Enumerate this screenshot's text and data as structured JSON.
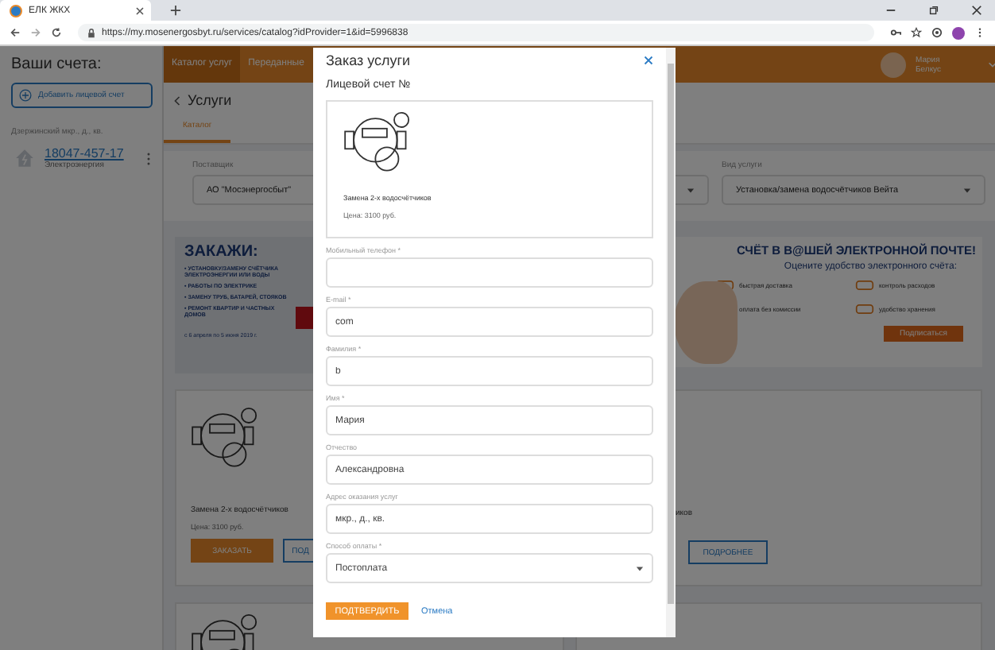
{
  "browser": {
    "tab_title": "ЕЛК ЖКХ",
    "url": "https://my.mosenergosbyt.ru/services/catalog?idProvider=1&id=5996838"
  },
  "sidebar": {
    "title": "Ваши счета:",
    "add_button": "Добавить лицевой счет",
    "address": "Дзержинский мкр., д., кв.",
    "accounts": [
      {
        "number": "18047-457-17",
        "type": "Электроэнергия"
      }
    ]
  },
  "header": {
    "nav": [
      {
        "label": "Каталог услуг",
        "selected": true
      },
      {
        "label": "Переданные",
        "selected": false
      }
    ],
    "user": {
      "first_name": "Мария",
      "last_name": "Белкус"
    }
  },
  "page": {
    "title": "Услуги",
    "tabs": [
      {
        "label": "Каталог",
        "selected": true
      }
    ],
    "filters": [
      {
        "label": "Поставщик",
        "value": "АО \"Мосэнергосбыт\""
      },
      {
        "label": "Вид услуги",
        "value": "Установка/замена водосчётчиков Вейта"
      }
    ],
    "promo_left": {
      "title": "ЗАКАЖИ:",
      "items": [
        "• УСТАНОВКУ/ЗАМЕНУ СЧЁТЧИКА ЭЛЕКТРОЭНЕРГИИ ИЛИ ВОДЫ",
        "• РАБОТЫ ПО ЭЛЕКТРИКЕ",
        "• ЗАМЕНУ ТРУБ, БАТАРЕЙ, СТОЯКОВ",
        "• РЕМОНТ КВАРТИР И ЧАСТНЫХ ДОМОВ"
      ],
      "dates": "с 6 апреля по 5 июня 2019 г."
    },
    "promo_right": {
      "title": "СЧЁТ В В@ШЕЙ ЭЛЕКТРОННОЙ ПОЧТЕ!",
      "subtitle": "Оцените удобство электронного счёта:",
      "features": [
        "быстрая доставка",
        "контроль расходов",
        "оплата без комиссии",
        "удобство хранения"
      ],
      "button": "Подписаться"
    },
    "cards": [
      {
        "name": "Замена 2-х водосчётчиков",
        "price": "Цена: 3100 руб.",
        "order_button": "ЗАКАЗАТЬ",
        "more_button": "ПОД"
      },
      {
        "name": "иков",
        "more_button": "ПОДРОБНЕЕ"
      }
    ]
  },
  "modal": {
    "title": "Заказ услуги",
    "account_label": "Лицевой счет №",
    "service": {
      "name": "Замена 2-х водосчётчиков",
      "price": "Цена: 3100 руб."
    },
    "fields": [
      {
        "kind": "input",
        "label": "Мобильный телефон *"
      },
      {
        "kind": "input",
        "label": "E-mail *",
        "value": "com"
      },
      {
        "kind": "input",
        "label": "Фамилия *",
        "value": "b"
      },
      {
        "kind": "input",
        "label": "Имя *",
        "value": "Мария"
      },
      {
        "kind": "input",
        "label": "Отчество",
        "value": "Александровна"
      },
      {
        "kind": "input",
        "label": "Адрес оказания услуг",
        "value": "мкр., д., кв."
      },
      {
        "kind": "select",
        "label": "Способ оплаты *",
        "value": "Постоплата"
      }
    ],
    "confirm_button": "ПОДТВЕРДИТЬ",
    "cancel_link": "Отмена"
  }
}
